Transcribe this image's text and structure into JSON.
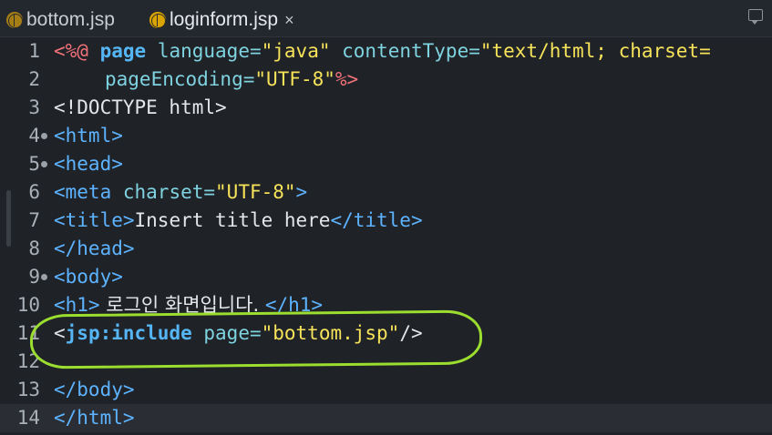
{
  "tabs": [
    {
      "label": "bottom.jsp",
      "icon": "jsp-file-icon",
      "active": false
    },
    {
      "label": "loginform.jsp",
      "icon": "jsp-file-icon",
      "active": true,
      "close": "×"
    }
  ],
  "editor": {
    "lines": [
      {
        "num": "1"
      },
      {
        "num": "2"
      },
      {
        "num": "3"
      },
      {
        "num": "4"
      },
      {
        "num": "5"
      },
      {
        "num": "6"
      },
      {
        "num": "7"
      },
      {
        "num": "8"
      },
      {
        "num": "9"
      },
      {
        "num": "10"
      },
      {
        "num": "11"
      },
      {
        "num": "12"
      },
      {
        "num": "13"
      },
      {
        "num": "14"
      }
    ],
    "code": {
      "l1_open": "<%@",
      "l1_page": "page",
      "l1_attr1": "language=",
      "l1_val1": "\"java\"",
      "l1_attr2": "contentType=",
      "l1_val2": "\"text/html; charset=",
      "l2_attr": "pageEncoding=",
      "l2_val": "\"UTF-8\"",
      "l2_close": "%>",
      "l3": "<!DOCTYPE html>",
      "l4_tag": "<html>",
      "l5_tag": "<head>",
      "l6_tag": "<meta",
      "l6_attr": "charset=",
      "l6_val": "\"UTF-8\"",
      "l6_close": ">",
      "l7_open": "<title>",
      "l7_text": "Insert title here",
      "l7_close": "</title>",
      "l8_tag": "</head>",
      "l9_tag": "<body>",
      "l10_open": "<h1>",
      "l10_text": " 로그인 화면입니다. ",
      "l10_close": "</h1>",
      "l11_lt": "<",
      "l11_tag": "jsp:include",
      "l11_attr": "page=",
      "l11_val": "\"bottom.jsp\"",
      "l11_close": "/>",
      "l13_tag": "</body>",
      "l14_tag": "</html>"
    }
  },
  "colors": {
    "background": "#1f2227",
    "annotation": "#9cde2f"
  }
}
